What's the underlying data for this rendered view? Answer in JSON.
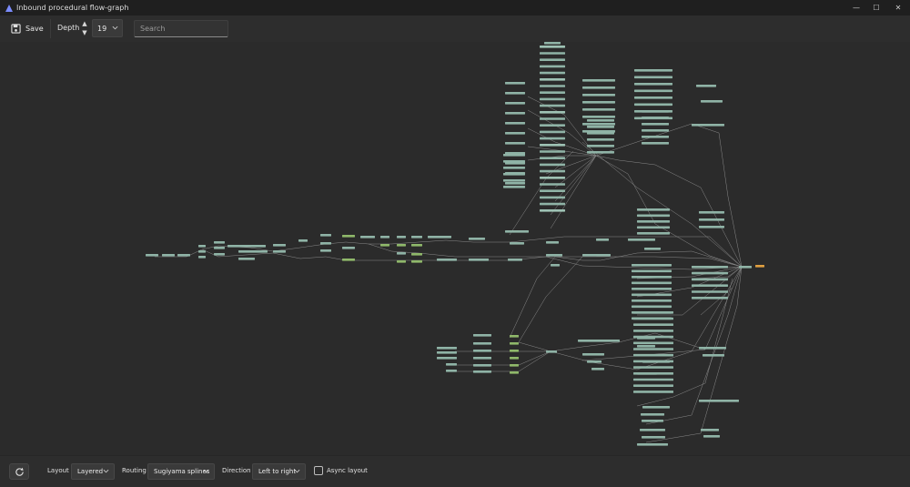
{
  "window": {
    "title": "Inbound procedural flow-graph",
    "minimize_glyph": "—",
    "maximize_glyph": "☐",
    "close_glyph": "✕"
  },
  "toolbar": {
    "save_label": "Save",
    "depth_label": "Depth",
    "depth_value": "19",
    "search_placeholder": "Search"
  },
  "bottom": {
    "layout_label": "Layout",
    "layout_value": "Layered",
    "routing_label": "Routing",
    "routing_value": "Sugiyama splines",
    "direction_label": "Direction",
    "direction_value": "Left to right",
    "async_label": "Async layout",
    "async_checked": false
  },
  "icons": {
    "app": "app-logo-icon",
    "save": "save-icon",
    "up": "arrow-up-icon",
    "down": "arrow-down-icon",
    "chevron": "chevron-down-icon",
    "refresh": "refresh-icon"
  },
  "colors": {
    "node_fill": "#8fb3a6",
    "node_fill_alt": "#9ec2b4",
    "node_highlight": "#8fb86a",
    "sink_node": "#e0a040",
    "edge": "#a9a9a9"
  }
}
